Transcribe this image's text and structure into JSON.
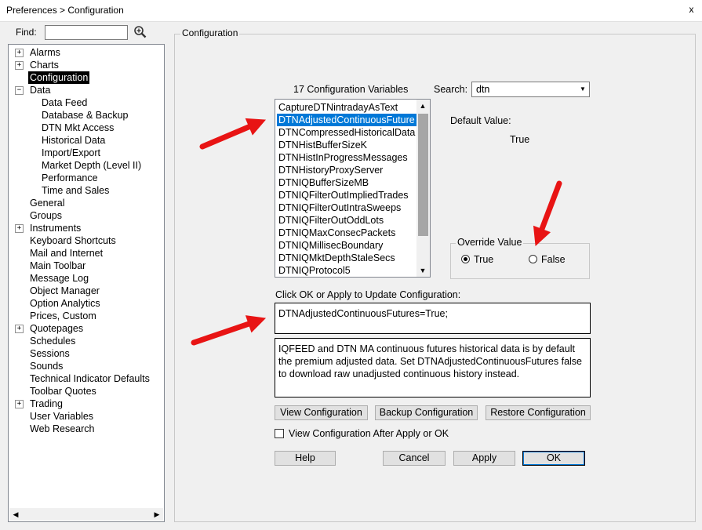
{
  "window": {
    "title": "Preferences > Configuration",
    "close_glyph": "x"
  },
  "find": {
    "label": "Find:",
    "value": ""
  },
  "tree": {
    "items": [
      {
        "label": "Alarms",
        "expander": "+"
      },
      {
        "label": "Charts",
        "expander": "+"
      },
      {
        "label": "Configuration",
        "selected": true
      },
      {
        "label": "Data",
        "expander": "−"
      },
      {
        "label": "Data Feed"
      },
      {
        "label": "Database & Backup"
      },
      {
        "label": "DTN Mkt Access"
      },
      {
        "label": "Historical Data"
      },
      {
        "label": "Import/Export"
      },
      {
        "label": "Market Depth (Level II)"
      },
      {
        "label": "Performance"
      },
      {
        "label": "Time and Sales"
      },
      {
        "label": "General"
      },
      {
        "label": "Groups"
      },
      {
        "label": "Instruments",
        "expander": "+"
      },
      {
        "label": "Keyboard Shortcuts"
      },
      {
        "label": "Mail and Internet"
      },
      {
        "label": "Main Toolbar"
      },
      {
        "label": "Message Log"
      },
      {
        "label": "Object Manager"
      },
      {
        "label": "Option Analytics"
      },
      {
        "label": "Prices, Custom"
      },
      {
        "label": "Quotepages",
        "expander": "+"
      },
      {
        "label": "Schedules"
      },
      {
        "label": "Sessions"
      },
      {
        "label": "Sounds"
      },
      {
        "label": "Technical Indicator Defaults"
      },
      {
        "label": "Toolbar Quotes"
      },
      {
        "label": "Trading",
        "expander": "+"
      },
      {
        "label": "User Variables"
      },
      {
        "label": "Web Research"
      }
    ]
  },
  "config": {
    "group_label": "Configuration",
    "count_label": "17 Configuration Variables",
    "search_label": "Search:",
    "search_value": "dtn",
    "variables": [
      "CaptureDTNintradayAsText",
      "DTNAdjustedContinuousFuture",
      "DTNCompressedHistoricalData",
      "DTNHistBufferSizeK",
      "DTNHistInProgressMessages",
      "DTNHistoryProxyServer",
      "DTNIQBufferSizeMB",
      "DTNIQFilterOutImpliedTrades",
      "DTNIQFilterOutIntraSweeps",
      "DTNIQFilterOutOddLots",
      "DTNIQMaxConsecPackets",
      "DTNIQMillisecBoundary",
      "DTNIQMktDepthStaleSecs",
      "DTNIQProtocol5"
    ],
    "selected_variable": "DTNAdjustedContinuousFuture",
    "default_label": "Default Value:",
    "default_value": "True",
    "override": {
      "label": "Override Value",
      "true_label": "True",
      "false_label": "False",
      "selected": "True"
    },
    "update_label": "Click OK or Apply to Update Configuration:",
    "update_text": "DTNAdjustedContinuousFutures=True;",
    "description": "IQFEED and DTN MA continuous futures historical data is by default the premium adjusted data. Set DTNAdjustedContinuousFutures false to download raw unadjusted continuous history instead.",
    "buttons": {
      "view": "View Configuration",
      "backup": "Backup Configuration",
      "restore": "Restore Configuration",
      "help": "Help",
      "cancel": "Cancel",
      "apply": "Apply",
      "ok": "OK"
    },
    "view_after_label": "View Configuration After Apply or OK",
    "view_after_checked": false
  },
  "colors": {
    "annotation_arrow": "#e81414",
    "selection": "#0078d7"
  }
}
